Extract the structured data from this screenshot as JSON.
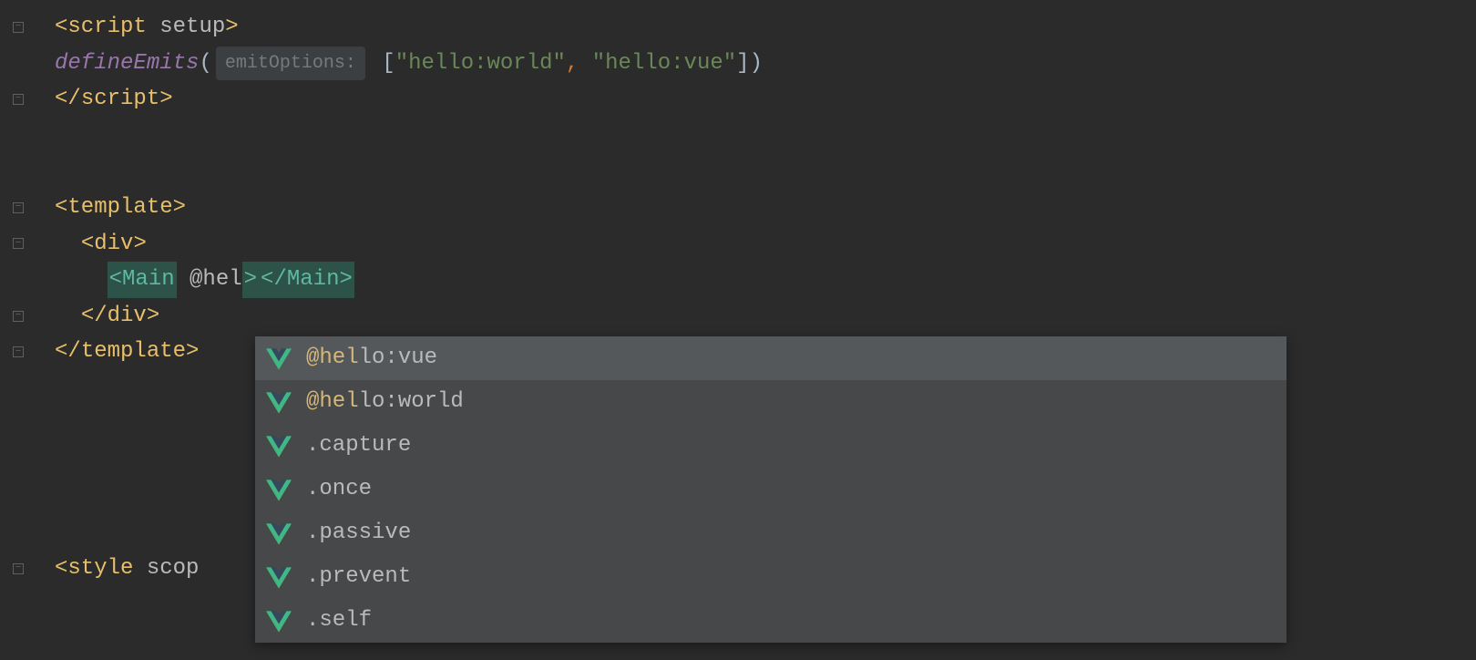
{
  "code": {
    "line1": {
      "open": "<",
      "tag": "script",
      "attr": " setup",
      "close": ">"
    },
    "line2": {
      "func": "defineEmits",
      "open_paren": "(",
      "hint": "emitOptions:",
      "bracket_open": "[",
      "str1": "\"hello:world\"",
      "comma": ",",
      "str2": "\"hello:vue\"",
      "bracket_close": "]",
      "close_paren": ")"
    },
    "line3": {
      "open": "</",
      "tag": "script",
      "close": ">"
    },
    "line5": {
      "open": "<",
      "tag": "template",
      "close": ">"
    },
    "line6": {
      "indent": "  ",
      "open": "<",
      "tag": "div",
      "close": ">"
    },
    "line7": {
      "indent": "    ",
      "open_tag_o": "<",
      "comp_name": "Main",
      "attr": " @hel",
      "open_tag_c": ">",
      "close_tag_o": "</",
      "close_comp": "Main",
      "close_tag_c": ">"
    },
    "line8": {
      "indent": "  ",
      "open": "</",
      "tag": "div",
      "close": ">"
    },
    "line9": {
      "open": "</",
      "tag": "template",
      "close": ">"
    },
    "line11": {
      "open": "<",
      "tag": "style",
      "attr": " scop"
    }
  },
  "autocomplete": {
    "items": [
      {
        "prefix": "@hel",
        "suffix": "lo:vue",
        "selected": true
      },
      {
        "prefix": "@hel",
        "suffix": "lo:world",
        "selected": false
      },
      {
        "prefix": "",
        "suffix": ".capture",
        "selected": false
      },
      {
        "prefix": "",
        "suffix": ".once",
        "selected": false
      },
      {
        "prefix": "",
        "suffix": ".passive",
        "selected": false
      },
      {
        "prefix": "",
        "suffix": ".prevent",
        "selected": false
      },
      {
        "prefix": "",
        "suffix": ".self",
        "selected": false
      }
    ]
  },
  "colors": {
    "background": "#2b2b2b",
    "tag": "#e8bf6a",
    "string": "#6a8759",
    "func": "#9876aa",
    "popup": "#46484a",
    "match": "#d5b778",
    "vue_green": "#41b883"
  }
}
